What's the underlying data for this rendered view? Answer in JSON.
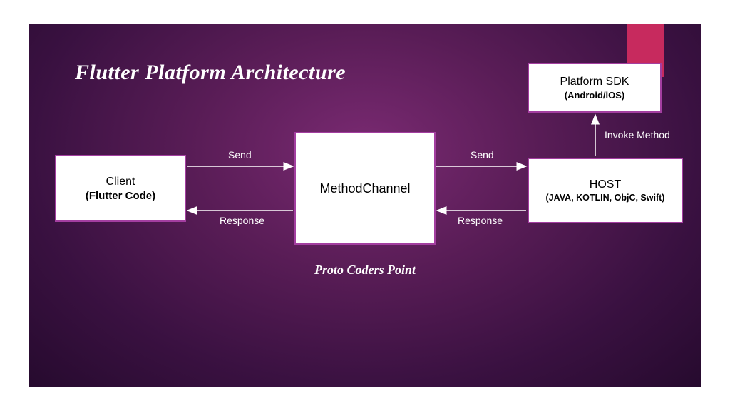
{
  "title": "Flutter Platform Architecture",
  "credit": "Proto Coders Point",
  "boxes": {
    "client": {
      "line1": "Client",
      "line2": "(Flutter Code)"
    },
    "method": {
      "line1": "MethodChannel",
      "line2": ""
    },
    "host": {
      "line1": "HOST",
      "line2": "(JAVA, KOTLIN, ObjC, Swift)"
    },
    "sdk": {
      "line1": "Platform SDK",
      "line2": "(Android/iOS)"
    }
  },
  "labels": {
    "send_left": "Send",
    "response_left": "Response",
    "send_right": "Send",
    "response_right": "Response",
    "invoke": "Invoke Method"
  },
  "colors": {
    "accent": "#c72a5e",
    "box_border": "#a33ea0"
  }
}
